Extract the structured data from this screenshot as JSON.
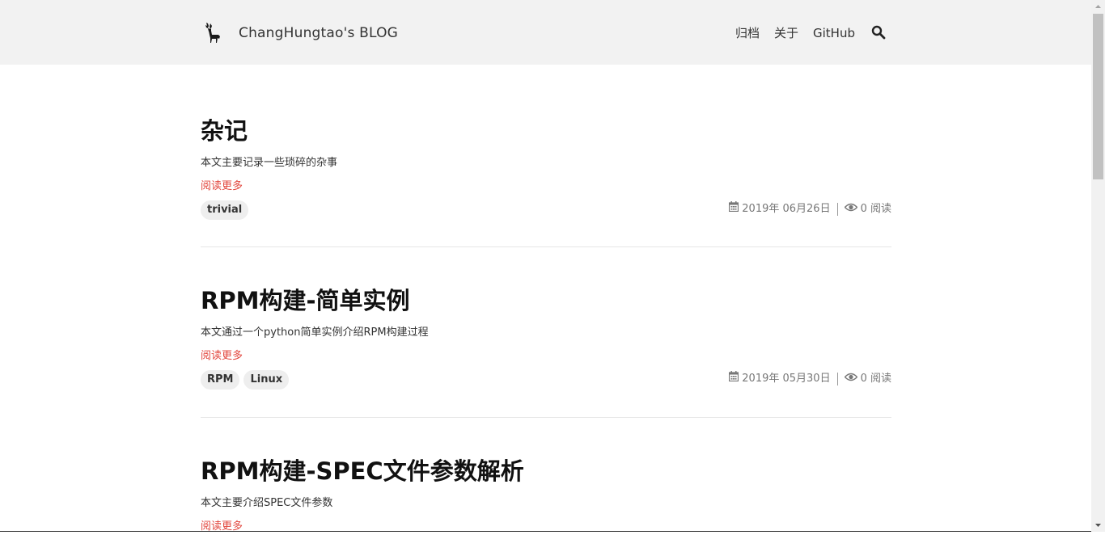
{
  "header": {
    "site_title": "ChangHungtao's BLOG",
    "logo_icon": "deer-logo-icon",
    "nav": {
      "archive": "归档",
      "about": "关于",
      "github": "GitHub"
    },
    "search_icon": "search-icon"
  },
  "posts": [
    {
      "title": "杂记",
      "summary": "本文主要记录一些琐碎的杂事",
      "read_more": "阅读更多",
      "tags": [
        "trivial"
      ],
      "date": "2019年 06月26日",
      "views": "0 阅读"
    },
    {
      "title": "RPM构建-简单实例",
      "summary": "本文通过一个python简单实例介绍RPM构建过程",
      "read_more": "阅读更多",
      "tags": [
        "RPM",
        "Linux"
      ],
      "date": "2019年 05月30日",
      "views": "0 阅读"
    },
    {
      "title": "RPM构建-SPEC文件参数解析",
      "summary": "本文主要介绍SPEC文件参数",
      "read_more": "阅读更多"
    }
  ],
  "colors": {
    "header_bg": "#f2f2f2",
    "read_more": "#e2453c",
    "tag_bg": "#eeeeee",
    "meta_text": "#777777"
  }
}
